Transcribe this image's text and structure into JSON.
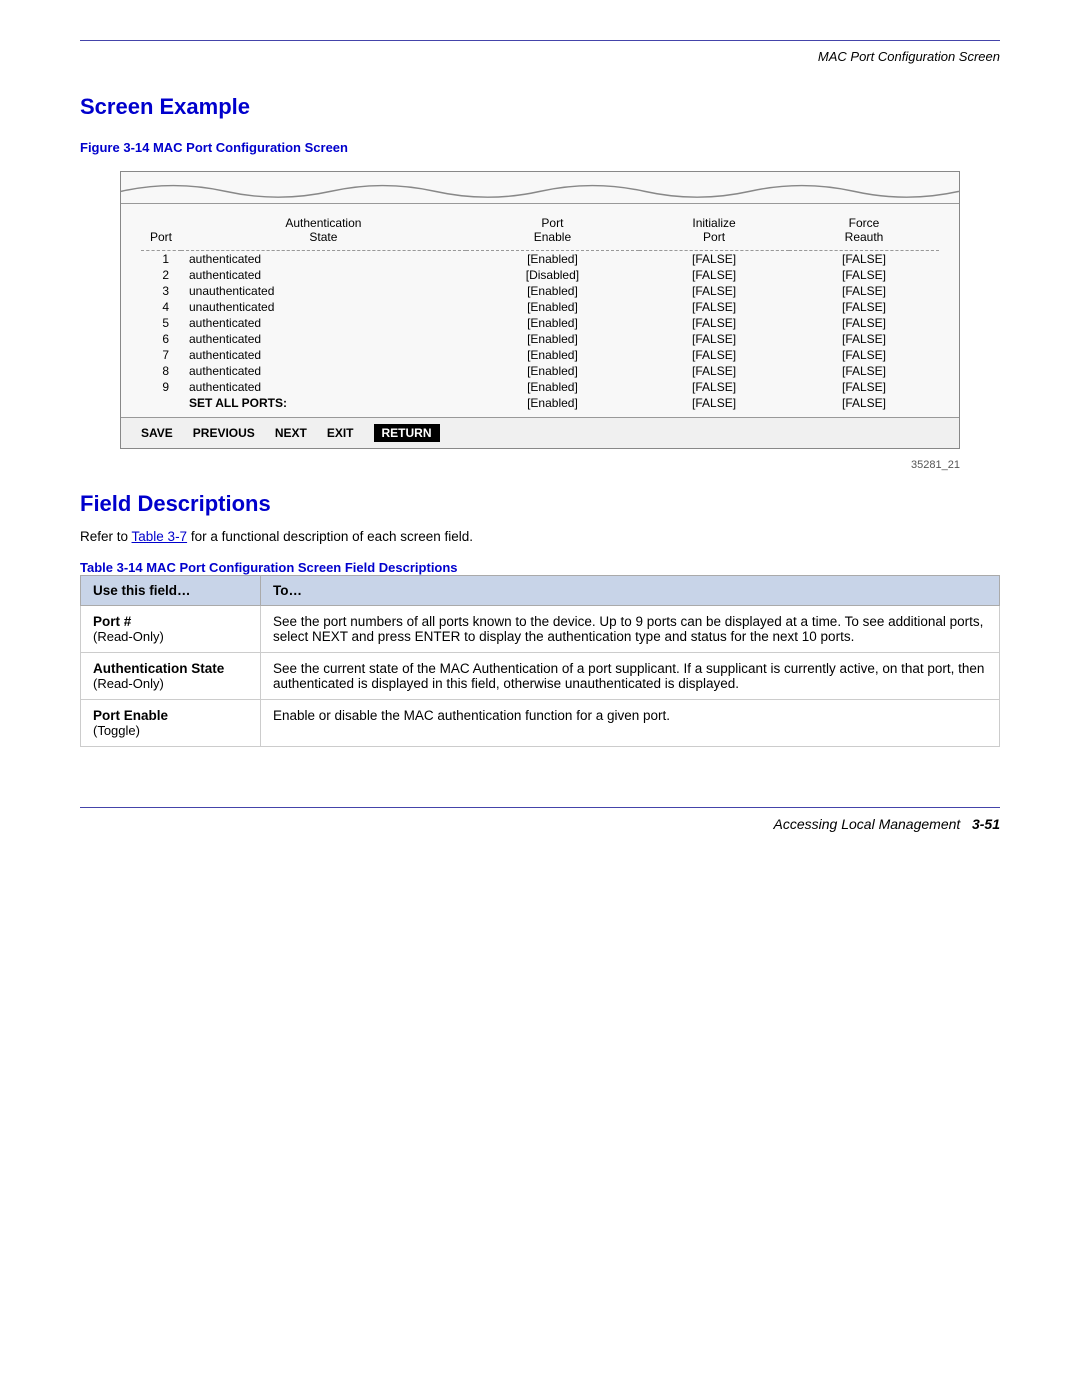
{
  "header": {
    "rule": true,
    "title": "MAC Port Configuration Screen"
  },
  "screen_example": {
    "section_title": "Screen Example",
    "figure_caption": "Figure 3-14   MAC Port Configuration Screen",
    "figure_number": "35281_21",
    "screen": {
      "columns": [
        "Port",
        "Authentication\nState",
        "Port\nEnable",
        "Initialize\nPort",
        "Force\nReauth"
      ],
      "rows": [
        {
          "port": "1",
          "auth_state": "authenticated",
          "port_enable": "[Enabled]",
          "init_port": "[FALSE]",
          "force_reauth": "[FALSE]"
        },
        {
          "port": "2",
          "auth_state": "authenticated",
          "port_enable": "[Disabled]",
          "init_port": "[FALSE]",
          "force_reauth": "[FALSE]"
        },
        {
          "port": "3",
          "auth_state": "unauthenticated",
          "port_enable": "[Enabled]",
          "init_port": "[FALSE]",
          "force_reauth": "[FALSE]"
        },
        {
          "port": "4",
          "auth_state": "unauthenticated",
          "port_enable": "[Enabled]",
          "init_port": "[FALSE]",
          "force_reauth": "[FALSE]"
        },
        {
          "port": "5",
          "auth_state": "authenticated",
          "port_enable": "[Enabled]",
          "init_port": "[FALSE]",
          "force_reauth": "[FALSE]"
        },
        {
          "port": "6",
          "auth_state": "authenticated",
          "port_enable": "[Enabled]",
          "init_port": "[FALSE]",
          "force_reauth": "[FALSE]"
        },
        {
          "port": "7",
          "auth_state": "authenticated",
          "port_enable": "[Enabled]",
          "init_port": "[FALSE]",
          "force_reauth": "[FALSE]"
        },
        {
          "port": "8",
          "auth_state": "authenticated",
          "port_enable": "[Enabled]",
          "init_port": "[FALSE]",
          "force_reauth": "[FALSE]"
        },
        {
          "port": "9",
          "auth_state": "authenticated",
          "port_enable": "[Enabled]",
          "init_port": "[FALSE]",
          "force_reauth": "[FALSE]"
        }
      ],
      "set_all_ports": {
        "label": "SET ALL PORTS:",
        "port_enable": "[Enabled]",
        "init_port": "[FALSE]",
        "force_reauth": "[FALSE]"
      },
      "buttons": [
        "SAVE",
        "PREVIOUS",
        "NEXT",
        "EXIT",
        "RETURN"
      ]
    }
  },
  "field_descriptions": {
    "section_title": "Field Descriptions",
    "refer_text": "Refer to ",
    "refer_link": "Table 3-7",
    "refer_suffix": " for a functional description of each screen field.",
    "table_caption": "Table 3-14   MAC Port Configuration Screen Field Descriptions",
    "table_headers": [
      "Use this field…",
      "To…"
    ],
    "rows": [
      {
        "field_name": "Port #",
        "field_note": "(Read-Only)",
        "description": "See the port numbers of all ports known to the device. Up to 9 ports can be displayed at a time. To see additional ports, select NEXT and press ENTER to display the authentication type and status for the next 10 ports."
      },
      {
        "field_name": "Authentication State",
        "field_note": "(Read-Only)",
        "description": "See the current state of the MAC Authentication of a port supplicant. If a supplicant is currently active, on that port, then authenticated is displayed in this field, otherwise unauthenticated is displayed."
      },
      {
        "field_name": "Port Enable",
        "field_note": "(Toggle)",
        "description": "Enable or disable the MAC authentication function for a given port."
      }
    ]
  },
  "footer": {
    "text": "Accessing Local Management",
    "page": "3-51"
  }
}
